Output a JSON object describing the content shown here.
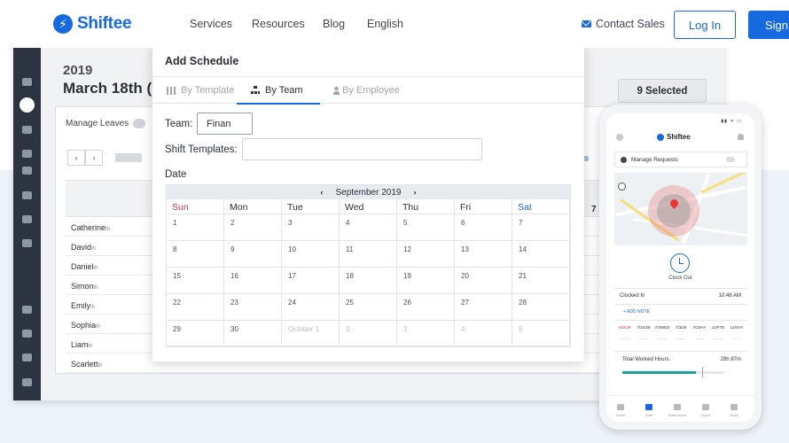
{
  "nav": {
    "logo": "Shiftee",
    "links": [
      "Services",
      "Resources",
      "Blog",
      "English"
    ],
    "contact": "Contact Sales",
    "login": "Log In",
    "signup": "Sign"
  },
  "app": {
    "year": "2019",
    "date": "March 18th (",
    "selected": "9 Selected",
    "manage_leaves": "Manage Leaves",
    "prev": "‹",
    "next": "›",
    "column": "7",
    "employees": [
      "Catherine",
      "David",
      "Daniel",
      "Simon",
      "Emily",
      "Sophia",
      "Liam",
      "Scarlett"
    ],
    "suffix": "th"
  },
  "modal": {
    "title": "Add Schedule",
    "tabs": [
      "By Template",
      "By Team",
      "By Employee"
    ],
    "team_label": "Team:",
    "team_value": "Finan",
    "shift_label": "Shift Templates:",
    "date_label": "Date",
    "calendar": {
      "month": "September 2019",
      "prev": "‹",
      "next": "›",
      "weekdays": [
        "Sun",
        "Mon",
        "Tue",
        "Wed",
        "Thu",
        "Fri",
        "Sat"
      ],
      "weeks": [
        [
          "1",
          "2",
          "3",
          "4",
          "5",
          "6",
          "7"
        ],
        [
          "8",
          "9",
          "10",
          "11",
          "12",
          "13",
          "14"
        ],
        [
          "15",
          "16",
          "17",
          "18",
          "19",
          "20",
          "21"
        ],
        [
          "22",
          "23",
          "24",
          "25",
          "26",
          "27",
          "28"
        ],
        [
          "29",
          "30",
          "October 1",
          "2",
          "3",
          "4",
          "5"
        ]
      ]
    }
  },
  "phone": {
    "status": "▮▮ ᯤ ▭",
    "logo": "Shiftee",
    "manage_requests": "Manage Requests",
    "clock_out": "Clock Out",
    "clocked_in": "Clocked In",
    "clocked_time": "10:48 AM",
    "add_note": "+ ADD NOTE",
    "week": [
      {
        "day": "6/OUR",
        "red": true
      },
      {
        "day": "7/24/28",
        "red": false
      },
      {
        "day": "7/3WED",
        "red": false
      },
      {
        "day": "7/3/28",
        "red": false
      },
      {
        "day": "TODAY",
        "red": false
      },
      {
        "day": "11/FTE",
        "red": false
      },
      {
        "day": "12/SAT",
        "red": false
      }
    ],
    "total_label": "Total Worked Hours",
    "total_value": "28h 87m",
    "progress": 0.72,
    "tabs": [
      "Home",
      "Staff",
      "Attendance",
      "Leave",
      "More"
    ]
  }
}
